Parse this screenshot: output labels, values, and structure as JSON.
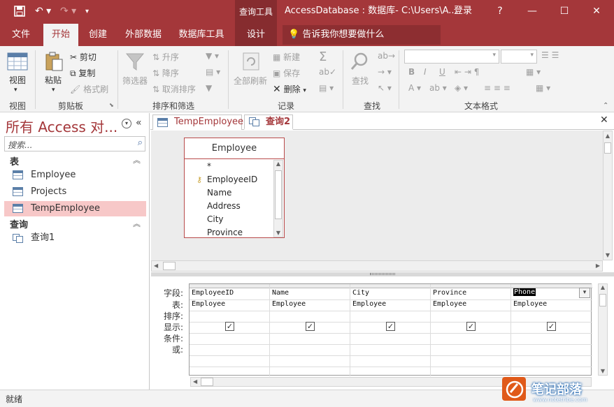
{
  "titlebar": {
    "context_tools": "查询工具",
    "window_title": "AccessDatabase : 数据库- C:\\Users\\A...",
    "login": "登录",
    "help": "?",
    "minimize": "—",
    "restore": "☐",
    "close": "✕"
  },
  "tabs": [
    "文件",
    "开始",
    "创建",
    "外部数据",
    "数据库工具",
    "设计"
  ],
  "tell_me": "告诉我你想要做什么",
  "ribbon": {
    "view": "视图",
    "paste": "粘贴",
    "cut": "剪切",
    "copy": "复制",
    "format_painter": "格式刷",
    "filter": "筛选器",
    "ascending": "升序",
    "descending": "降序",
    "remove_sort": "取消排序",
    "refresh_all": "全部刷新",
    "new": "新建",
    "save": "保存",
    "delete": "删除",
    "find": "查找",
    "groups": {
      "view": "视图",
      "clipboard": "剪贴板",
      "sort_filter": "排序和筛选",
      "records": "记录",
      "find": "查找",
      "text_format": "文本格式"
    }
  },
  "nav": {
    "title": "所有 Access 对...",
    "search_placeholder": "搜索...",
    "sections": [
      {
        "label": "表",
        "items": [
          "Employee",
          "Projects",
          "TempEmployee"
        ]
      },
      {
        "label": "查询",
        "items": [
          "查询1"
        ]
      }
    ]
  },
  "doc_tabs": [
    "TempEmployee",
    "查询2"
  ],
  "field_list": {
    "title": "Employee",
    "fields": [
      "*",
      "EmployeeID",
      "Name",
      "Address",
      "City",
      "Province"
    ]
  },
  "grid": {
    "row_labels": [
      "字段:",
      "表:",
      "排序:",
      "显示:",
      "条件:",
      "或:"
    ],
    "columns": [
      {
        "field": "EmployeeID",
        "table": "Employee",
        "show": true
      },
      {
        "field": "Name",
        "table": "Employee",
        "show": true
      },
      {
        "field": "City",
        "table": "Employee",
        "show": true
      },
      {
        "field": "Province",
        "table": "Employee",
        "show": true
      },
      {
        "field": "Phone",
        "table": "Employee",
        "show": true
      }
    ]
  },
  "status": "就绪",
  "watermark": {
    "line1": "笔记部落",
    "line2": "www.notetribe.com"
  }
}
